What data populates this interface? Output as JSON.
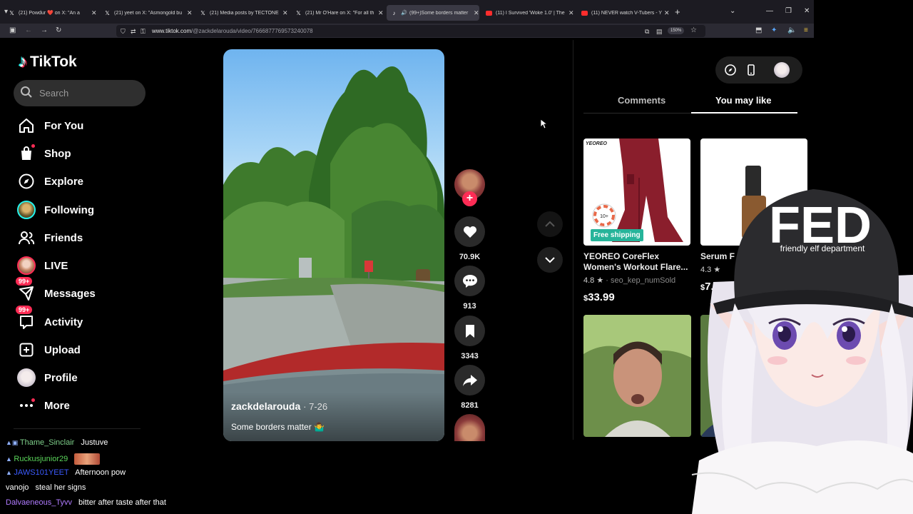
{
  "browser": {
    "tabs": [
      {
        "favicon": "x-logo",
        "title": "(21) Powdur ❤️ on X: \"An a"
      },
      {
        "favicon": "x-logo",
        "title": "(21) yeet on X: \"Asmongold bu"
      },
      {
        "favicon": "x-logo",
        "title": "(21) Media posts by TECTONE"
      },
      {
        "favicon": "x-logo",
        "title": "(21) Mr O'Hare on X: \"For all th"
      },
      {
        "favicon": "tiktok-logo",
        "title": "(99+)Some borders matter"
      },
      {
        "favicon": "youtube-logo",
        "title": "(11) I Survived 'Woke 1.0' | The"
      },
      {
        "favicon": "youtube-logo",
        "title": "(11) NEVER watch V-Tubers - Y"
      }
    ],
    "active_tab": 4,
    "url_domain": "www.tiktok.com",
    "url_path": "/@zackdelarouda/video/7666877769573240078",
    "zoom": "150%"
  },
  "tiktok": {
    "logo_text": "TikTok",
    "search_placeholder": "Search",
    "nav": [
      {
        "icon": "home-icon",
        "label": "For You"
      },
      {
        "icon": "shop-icon",
        "label": "Shop"
      },
      {
        "icon": "explore-icon",
        "label": "Explore"
      },
      {
        "icon": "following-avatar",
        "label": "Following"
      },
      {
        "icon": "friends-icon",
        "label": "Friends"
      },
      {
        "icon": "live-avatar",
        "label": "LIVE"
      },
      {
        "icon": "messages-icon",
        "label": "Messages",
        "badge": "99+"
      },
      {
        "icon": "activity-icon",
        "label": "Activity",
        "badge": "99+"
      },
      {
        "icon": "upload-icon",
        "label": "Upload"
      },
      {
        "icon": "profile-avatar",
        "label": "Profile"
      },
      {
        "icon": "more-icon",
        "label": "More"
      }
    ],
    "video": {
      "author": "zackdelarouda",
      "date": "· 7-26",
      "caption": "Some borders matter 🤷‍♂️"
    },
    "actions": {
      "likes": "70.9K",
      "comments": "913",
      "saves": "3343",
      "shares": "8281"
    },
    "panel": {
      "tabs": [
        "Comments",
        "You may like"
      ],
      "active_tab": 1,
      "products": [
        {
          "brand": "YEOREO",
          "badge": "Free shipping",
          "title": "YEOREO CoreFlex Women's Workout Flare...",
          "rating": "4.8",
          "sold": "seo_kep_numSold",
          "price": "33.99",
          "currency": "$"
        },
        {
          "title": "Serum F",
          "rating": "4.3",
          "price": "7.5",
          "currency": "$"
        }
      ]
    }
  },
  "chat": [
    {
      "name": "Thame_Sinclair",
      "name_color": "#7fd18b",
      "message": "Justuve"
    },
    {
      "name": "Ruckusjunior29",
      "name_color": "#5bd65b",
      "message": ""
    },
    {
      "name": "JAWS101YEET",
      "name_color": "#3b5bff",
      "message": "Afternoon pow"
    },
    {
      "name": "vanojo",
      "name_color": "#ffffff",
      "message": "steal her signs"
    },
    {
      "name": "Dalvaeneous_Tyvv",
      "name_color": "#b07bff",
      "message": "bitter after taste after that"
    }
  ],
  "overlay": {
    "hat_text": "FED",
    "hat_subtext": "friendly elf department"
  },
  "colors": {
    "tiktok_red": "#fe2c55",
    "tiktok_cyan": "#25f4ee",
    "free_shipping": "#26b49a"
  }
}
